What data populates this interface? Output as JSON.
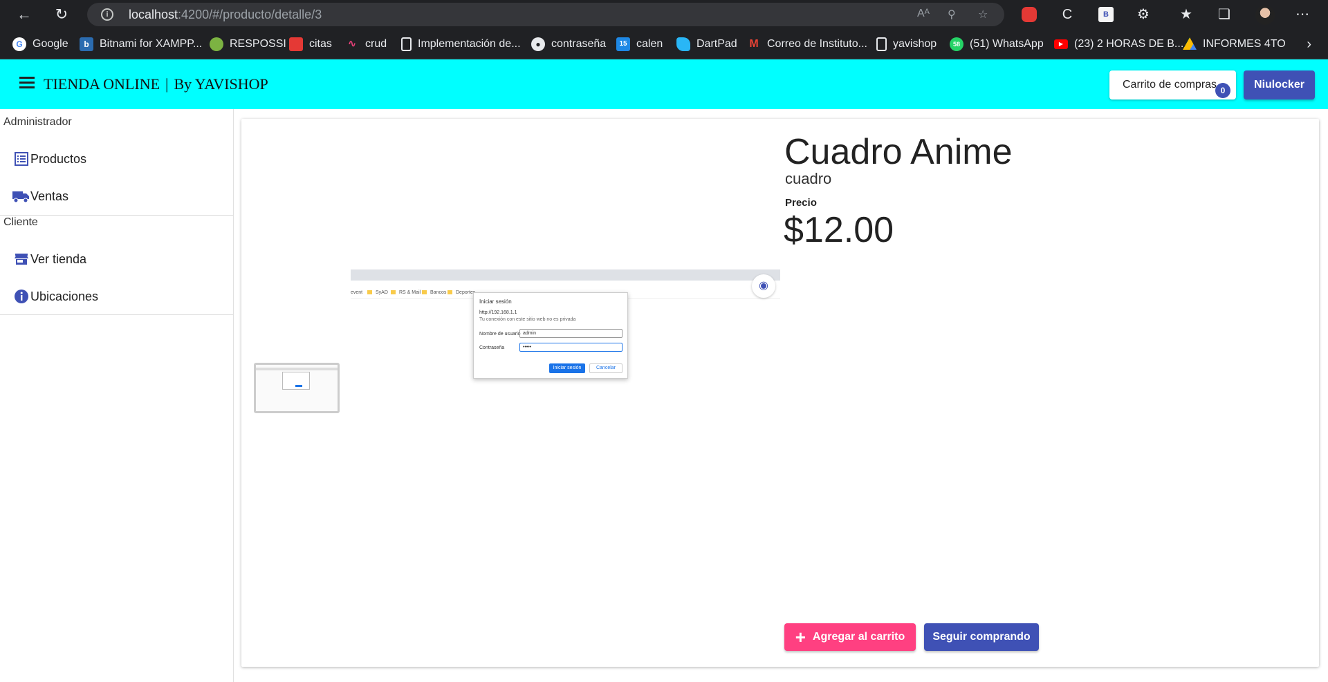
{
  "browser": {
    "url_host": "localhost",
    "url_path": ":4200/#/producto/detalle/3",
    "read_aloud": "Aᴬ",
    "bookmarks": [
      {
        "label": "Google",
        "icon": "google-icon",
        "color": "#4285f4"
      },
      {
        "label": "Bitnami for XAMPP...",
        "icon": "bitnami-icon",
        "color": "#2b6cb0"
      },
      {
        "label": "RESPOSSI",
        "icon": "leaf-icon",
        "color": "#7cb342"
      },
      {
        "label": "citas",
        "icon": "book-icon",
        "color": "#e53935"
      },
      {
        "label": "crud",
        "icon": "wave-icon",
        "color": "#ec407a"
      },
      {
        "label": "Implementación de...",
        "icon": "page-icon",
        "color": "#e8eaed"
      },
      {
        "label": "contraseña",
        "icon": "github-icon",
        "color": "#e8eaed"
      },
      {
        "label": "calen",
        "icon": "calendar-icon",
        "color": "#1e88e5"
      },
      {
        "label": "DartPad",
        "icon": "dart-icon",
        "color": "#29b6f6"
      },
      {
        "label": "Correo de Instituto...",
        "icon": "gmail-icon",
        "color": "#ea4335"
      },
      {
        "label": "yavishop",
        "icon": "page-icon",
        "color": "#e8eaed"
      },
      {
        "label": "(51) WhatsApp",
        "icon": "whatsapp-icon",
        "color": "#25d366"
      },
      {
        "label": "(23) 2 HORAS DE B...",
        "icon": "youtube-icon",
        "color": "#ff0000"
      },
      {
        "label": "INFORMES 4TO",
        "icon": "drive-icon",
        "color": "#fbbc04"
      }
    ]
  },
  "app": {
    "brand_left": "TIENDA ONLINE",
    "brand_sep": "|",
    "brand_right": "By YAVISHOP",
    "cart_label": "Carrito de compras",
    "cart_count": "0",
    "user_label": "Niulocker",
    "accent": "#00ffff",
    "primary": "#3f51b5",
    "pink": "#ff4081"
  },
  "sidebar": {
    "admin_title": "Administrador",
    "admin_items": [
      {
        "label": "Productos",
        "icon": "list-icon"
      },
      {
        "label": "Ventas",
        "icon": "truck-icon"
      }
    ],
    "client_title": "Cliente",
    "client_items": [
      {
        "label": "Ver tienda",
        "icon": "store-icon"
      },
      {
        "label": "Ubicaciones",
        "icon": "info-icon"
      }
    ]
  },
  "product": {
    "title": "Cuadro Anime",
    "subtitle": "cuadro",
    "price_label": "Precio",
    "price": "$12.00",
    "add_button": "Agregar al carrito",
    "continue_button": "Seguir comprando"
  },
  "image_content": {
    "bookmarks_strip": [
      "event",
      "SyAD",
      "RS & Mail",
      "Bancos",
      "Deportes"
    ],
    "dialog_title": "Iniciar sesión",
    "dialog_url": "http://192.168.1.1",
    "dialog_note": "Tu conexión con este sitio web no es privada",
    "user_label": "Nombre de usuario",
    "user_value": "admin",
    "pass_label": "Contraseña",
    "pass_value": "•••••",
    "ok_label": "Iniciar sesión",
    "cancel_label": "Cancelar"
  }
}
